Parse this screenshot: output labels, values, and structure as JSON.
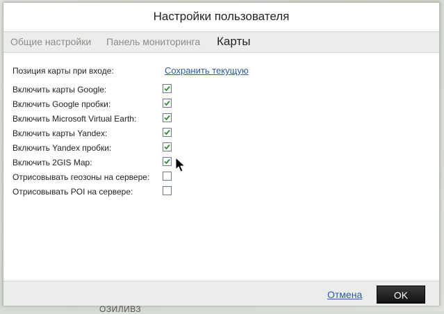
{
  "dialog": {
    "title": "Настройки пользователя"
  },
  "tabs": [
    {
      "label": "Общие настройки",
      "active": false
    },
    {
      "label": "Панель мониторинга",
      "active": false
    },
    {
      "label": "Карты",
      "active": true
    }
  ],
  "position": {
    "label": "Позиция карты при входе:",
    "link_label": "Сохранить текущую"
  },
  "options": [
    {
      "label": "Включить карты Google:",
      "checked": true
    },
    {
      "label": "Включить Google пробки:",
      "checked": true
    },
    {
      "label": "Включить Microsoft Virtual Earth:",
      "checked": true
    },
    {
      "label": "Включить карты Yandex:",
      "checked": true
    },
    {
      "label": "Включить Yandex пробки:",
      "checked": true
    },
    {
      "label": "Включить 2GIS Map:",
      "checked": true
    },
    {
      "label": "Отрисовывать геозоны на сервере:",
      "checked": false
    },
    {
      "label": "Отрисовывать POI на сервере:",
      "checked": false
    }
  ],
  "footer": {
    "cancel_label": "Отмена",
    "ok_label": "OK"
  },
  "background": {
    "fragment": "ОЗИЛИВЗ"
  },
  "colors": {
    "check": "#2e8b2e",
    "link": "#2b58a8"
  }
}
